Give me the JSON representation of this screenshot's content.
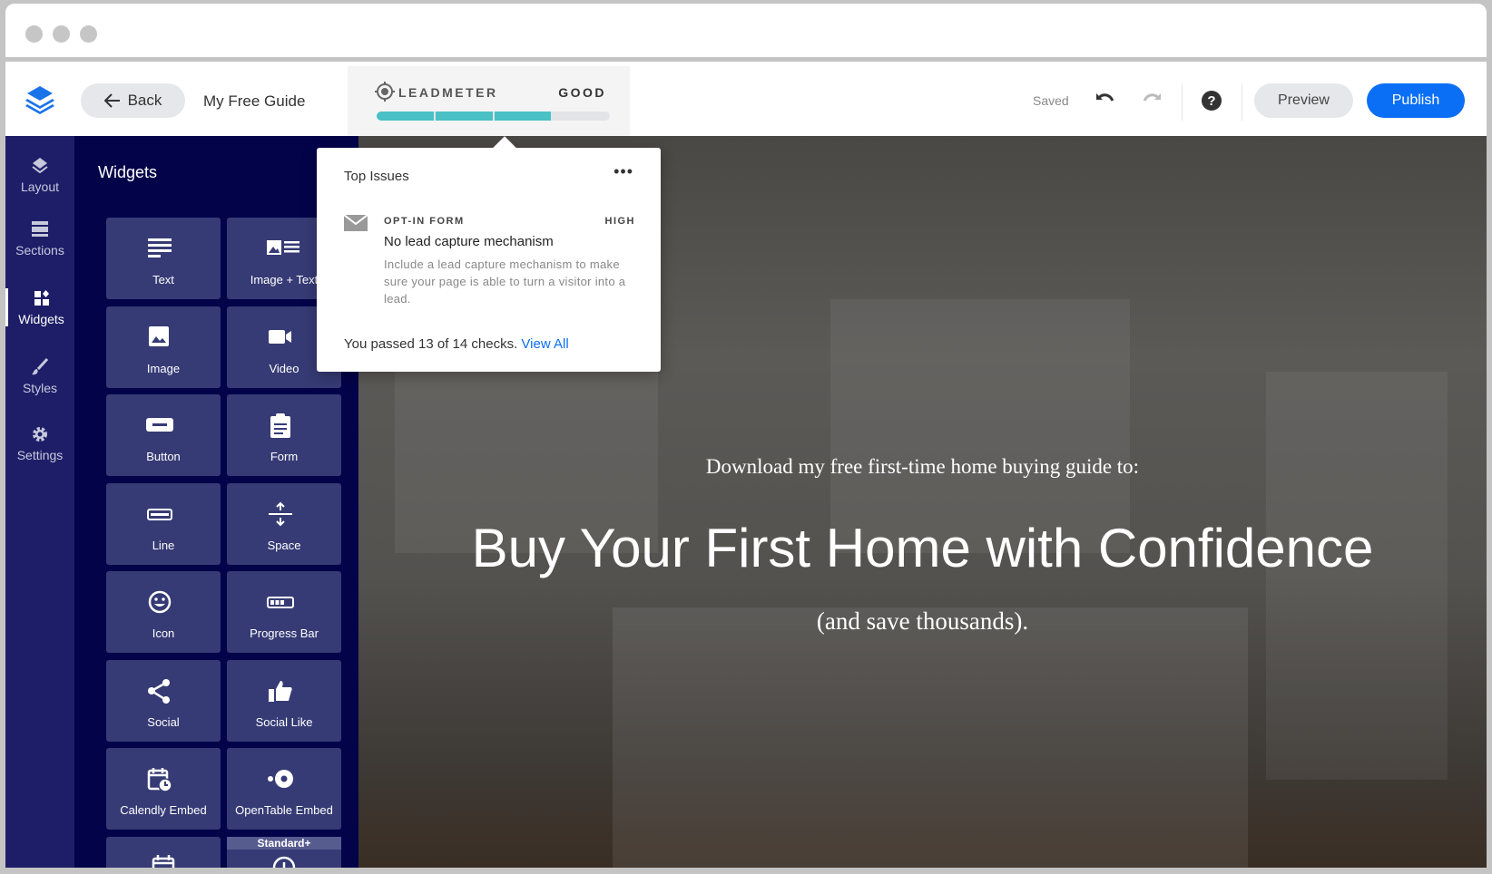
{
  "header": {
    "back_label": "Back",
    "page_title": "My Free Guide",
    "leadmeter": {
      "label": "LEADMETER",
      "rating": "GOOD",
      "level": 3,
      "max_level": 4,
      "fill_color": "#49c1c5"
    },
    "saved_label": "Saved",
    "preview_label": "Preview",
    "publish_label": "Publish"
  },
  "rail": [
    {
      "label": "Layout",
      "icon": "layers-icon"
    },
    {
      "label": "Sections",
      "icon": "sections-icon"
    },
    {
      "label": "Widgets",
      "icon": "widgets-icon",
      "active": true
    },
    {
      "label": "Styles",
      "icon": "brush-icon"
    },
    {
      "label": "Settings",
      "icon": "gear-icon"
    }
  ],
  "panel": {
    "title": "Widgets",
    "widgets": [
      {
        "label": "Text",
        "icon": "text"
      },
      {
        "label": "Image + Text",
        "icon": "imagetext"
      },
      {
        "label": "Image",
        "icon": "image"
      },
      {
        "label": "Video",
        "icon": "video"
      },
      {
        "label": "Button",
        "icon": "button"
      },
      {
        "label": "Form",
        "icon": "form"
      },
      {
        "label": "Line",
        "icon": "line"
      },
      {
        "label": "Space",
        "icon": "space"
      },
      {
        "label": "Icon",
        "icon": "smile"
      },
      {
        "label": "Progress Bar",
        "icon": "progress"
      },
      {
        "label": "Social",
        "icon": "share"
      },
      {
        "label": "Social Like",
        "icon": "thumb"
      },
      {
        "label": "Calendly Embed",
        "icon": "calendly"
      },
      {
        "label": "OpenTable Embed",
        "icon": "opentable"
      },
      {
        "label": "",
        "icon": "calendar"
      },
      {
        "label": "",
        "icon": "clock",
        "badge": "Standard+"
      }
    ]
  },
  "popover": {
    "title": "Top Issues",
    "more": "•••",
    "issue": {
      "category": "OPT-IN FORM",
      "severity": "HIGH",
      "heading": "No lead capture mechanism",
      "description": "Include a lead capture mechanism to make sure your page is able to turn a visitor into a lead."
    },
    "footer_text": "You passed 13 of 14 checks. ",
    "footer_link": "View All"
  },
  "canvas": {
    "subtitle": "Download my free first-time home buying guide to:",
    "headline": "Buy Your First Home with Confidence",
    "tagline": "(and save thousands)."
  }
}
